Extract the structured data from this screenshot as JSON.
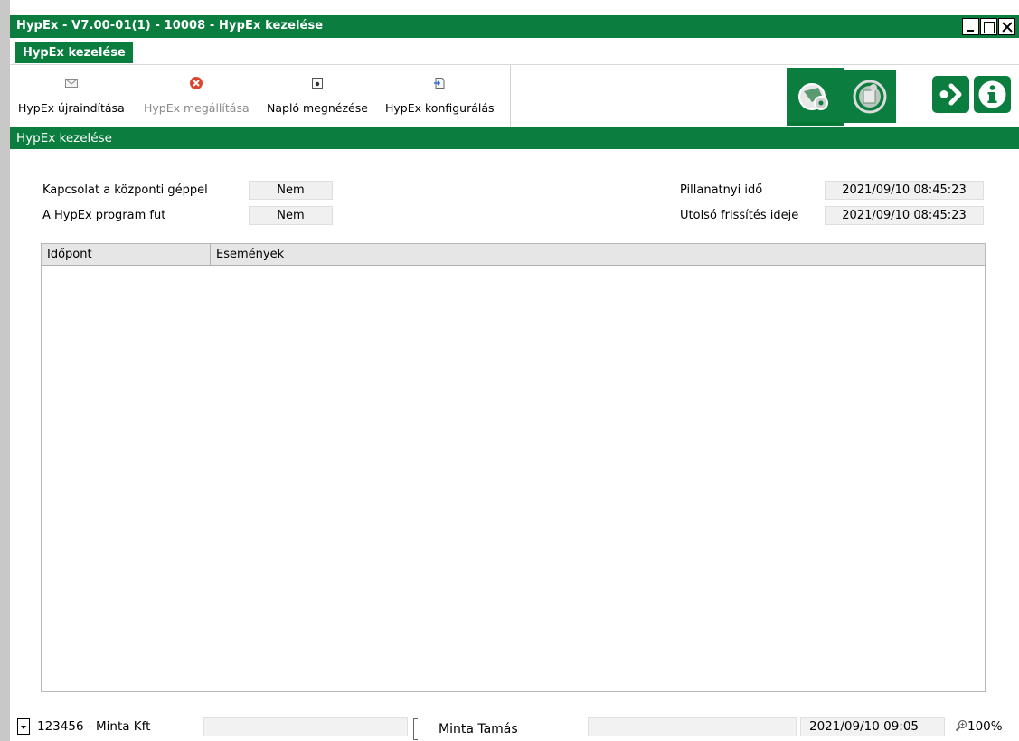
{
  "window": {
    "title": "HypEx - V7.00-01(1) - 10008 - HypEx kezelése"
  },
  "tabs": [
    {
      "label": "HypEx kezelése",
      "active": true
    }
  ],
  "toolbar": {
    "items": [
      {
        "label": "HypEx újraindítása",
        "icon": "envelope-icon",
        "enabled": true
      },
      {
        "label": "HypEx megállítása",
        "icon": "stop-icon",
        "enabled": false
      },
      {
        "label": "Napló megnézése",
        "icon": "document-view-icon",
        "enabled": true
      },
      {
        "label": "HypEx konfigurálás",
        "icon": "config-icon",
        "enabled": true
      }
    ],
    "right_icons": [
      "settings-module-icon",
      "refresh-module-icon",
      "exit-icon",
      "info-icon"
    ]
  },
  "section": {
    "title": "HypEx kezelése"
  },
  "status_fields": {
    "connection_label": "Kapcsolat a központi géppel",
    "connection_value": "Nem",
    "running_label": "A HypEx program fut",
    "running_value": "Nem",
    "current_time_label": "Pillanatnyi idő",
    "current_time_value": "2021/09/10 08:45:23",
    "last_refresh_label": "Utolsó frissítés ideje",
    "last_refresh_value": "2021/09/10 08:45:23"
  },
  "events_table": {
    "columns": [
      "Időpont",
      "Események"
    ],
    "rows": []
  },
  "statusbar": {
    "company": "123456 -  Minta Kft",
    "user": "Minta Tamás",
    "datetime": "2021/09/10 09:05",
    "zoom": "100%"
  },
  "colors": {
    "brand_green": "#0a7d3f",
    "disabled_text": "#8a8a8a",
    "stop_red": "#d9452f"
  }
}
